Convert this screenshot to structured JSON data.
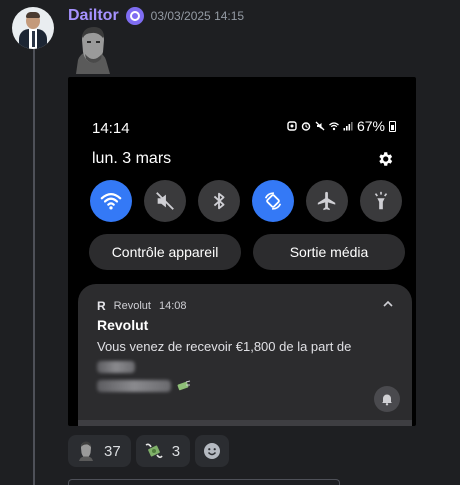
{
  "message": {
    "username": "Dailtor",
    "timestamp": "03/03/2025 14:15"
  },
  "phone": {
    "status_time": "14:14",
    "battery": "67%",
    "date": "lun. 3 mars",
    "quick_toggles": [
      {
        "name": "wifi",
        "active": true
      },
      {
        "name": "mute",
        "active": false
      },
      {
        "name": "bluetooth",
        "active": false
      },
      {
        "name": "auto-rotate",
        "active": true
      },
      {
        "name": "airplane",
        "active": false
      },
      {
        "name": "flashlight",
        "active": false
      }
    ],
    "device_control_label": "Contrôle appareil",
    "media_output_label": "Sortie média",
    "notification": {
      "app": "Revolut",
      "time": "14:08",
      "title": "Revolut",
      "body": "Vous venez de recevoir €1,800 de la part de"
    }
  },
  "reactions": [
    {
      "emoji": "gigachad",
      "count": "37"
    },
    {
      "emoji": "money-with-wings",
      "count": "3"
    }
  ],
  "colors": {
    "username": "#a692ff",
    "toggle_active": "#3479f6",
    "background": "#1e1f22"
  }
}
